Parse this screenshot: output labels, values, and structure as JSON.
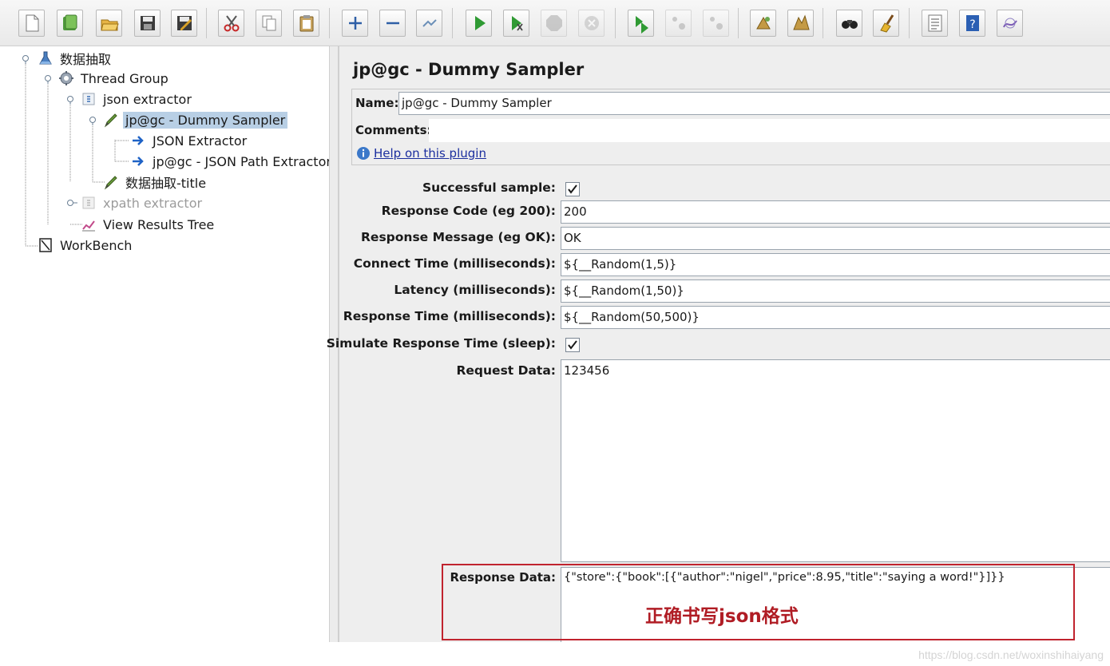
{
  "toolbar": {
    "buttons": [
      {
        "name": "new-icon"
      },
      {
        "name": "templates-icon"
      },
      {
        "name": "open-icon"
      },
      {
        "name": "save-icon"
      },
      {
        "name": "save-as-icon"
      },
      {
        "name": "cut-icon"
      },
      {
        "name": "copy-icon"
      },
      {
        "name": "paste-icon"
      },
      {
        "name": "expand-icon"
      },
      {
        "name": "collapse-icon"
      },
      {
        "name": "toggle-icon"
      },
      {
        "name": "start-icon"
      },
      {
        "name": "start-no-pause-icon"
      },
      {
        "name": "stop-icon"
      },
      {
        "name": "shutdown-icon"
      },
      {
        "name": "remote-start-icon"
      },
      {
        "name": "remote-stop-icon"
      },
      {
        "name": "remote-shutdown-icon"
      },
      {
        "name": "clear-icon"
      },
      {
        "name": "clear-all-icon"
      },
      {
        "name": "search-icon"
      },
      {
        "name": "reset-search-icon"
      },
      {
        "name": "function-helper-icon"
      },
      {
        "name": "help-icon"
      },
      {
        "name": "log-viewer-icon"
      }
    ]
  },
  "tree": {
    "nodes": [
      {
        "label": "数据抽取",
        "icon": "test-plan-icon"
      },
      {
        "label": "Thread Group",
        "icon": "gear-icon"
      },
      {
        "label": "json extractor",
        "icon": "controller-icon"
      },
      {
        "label": "jp@gc - Dummy Sampler",
        "icon": "sampler-pen-icon"
      },
      {
        "label": "JSON Extractor",
        "icon": "extractor-arrow-icon"
      },
      {
        "label": "jp@gc - JSON Path Extractor",
        "icon": "extractor-arrow-icon"
      },
      {
        "label": "数据抽取-title",
        "icon": "sampler-pen-icon"
      },
      {
        "label": "xpath extractor",
        "icon": "controller-icon"
      },
      {
        "label": "View Results Tree",
        "icon": "chart-icon"
      },
      {
        "label": "WorkBench",
        "icon": "workbench-icon"
      }
    ]
  },
  "editor": {
    "title": "jp@gc - Dummy Sampler",
    "name_label": "Name:",
    "name_value": "jp@gc - Dummy Sampler",
    "comments_label": "Comments:",
    "comments_value": "",
    "help_link": "Help on this plugin",
    "successful_label": "Successful sample:",
    "successful_checked": true,
    "response_code_label": "Response Code (eg 200):",
    "response_code_value": "200",
    "response_message_label": "Response Message (eg OK):",
    "response_message_value": "OK",
    "connect_time_label": "Connect Time (milliseconds):",
    "connect_time_value": "${__Random(1,5)}",
    "latency_label": "Latency (milliseconds):",
    "latency_value": "${__Random(1,50)}",
    "response_time_label": "Response Time (milliseconds):",
    "response_time_value": "${__Random(50,500)}",
    "simulate_label": "Simulate Response Time (sleep):",
    "simulate_checked": true,
    "request_data_label": "Request Data:",
    "request_data_value": "123456",
    "response_data_label": "Response Data:",
    "response_data_value": "{\"store\":{\"book\":[{\"author\":\"nigel\",\"price\":8.95,\"title\":\"saying a word!\"}]}}"
  },
  "annotation": {
    "text": "正确书写json格式",
    "color": "#b01c24"
  },
  "watermark": "https://blog.csdn.net/woxinshihaiyang",
  "colors": {
    "selection": "#b8cfe5",
    "panel_bg": "#eeeeee",
    "link": "#1b2e9e",
    "highlight_border": "#c0232e"
  }
}
